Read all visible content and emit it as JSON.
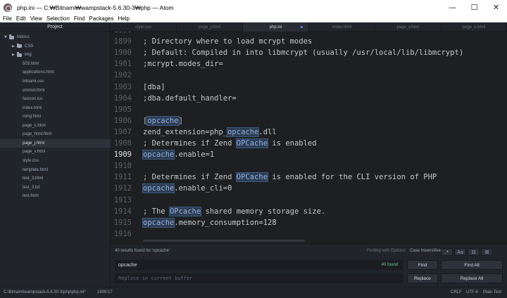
{
  "window": {
    "title": "php.ini — C:₩Bitnami₩wampstack-5.6.30-3₩php — Atom",
    "controls": {
      "minimize": "—",
      "maximize": "☐",
      "close": "✕"
    }
  },
  "menu": [
    "File",
    "Edit",
    "View",
    "Selection",
    "Find",
    "Packages",
    "Help"
  ],
  "tree": {
    "header": "Project",
    "items": [
      {
        "label": "htdocs",
        "type": "folder",
        "expanded": true
      },
      {
        "label": "CSS",
        "type": "folder",
        "expanded": false
      },
      {
        "label": "img",
        "type": "folder",
        "expanded": false
      },
      {
        "label": "503.html",
        "type": "file"
      },
      {
        "label": "applications.html",
        "type": "file"
      },
      {
        "label": "bitnami.css",
        "type": "file"
      },
      {
        "label": "emmet.html",
        "type": "file"
      },
      {
        "label": "favicon.ico",
        "type": "file"
      },
      {
        "label": "index.html",
        "type": "file"
      },
      {
        "label": "ming.html",
        "type": "file"
      },
      {
        "label": "page_c.html",
        "type": "file"
      },
      {
        "label": "page_html.html",
        "type": "file"
      },
      {
        "label": "page_j.html",
        "type": "file",
        "selected": true
      },
      {
        "label": "page_v.html",
        "type": "file"
      },
      {
        "label": "style.css",
        "type": "file"
      },
      {
        "label": "template.html",
        "type": "file"
      },
      {
        "label": "test_3.html",
        "type": "file"
      },
      {
        "label": "test_3.txt",
        "type": "file"
      },
      {
        "label": "test.html",
        "type": "file"
      }
    ]
  },
  "tabs": [
    {
      "label": "style.css"
    },
    {
      "label": "page_j.html"
    },
    {
      "label": "php.ini",
      "active": true,
      "modified": true
    },
    {
      "label": "index.html"
    },
    {
      "label": "page_v.html"
    },
    {
      "label": "page_c.html"
    }
  ],
  "editor": {
    "cursor_line": "1909",
    "lines": [
      {
        "num": "1898",
        "segs": []
      },
      {
        "num": "1899",
        "segs": [
          {
            "t": "; Directory where to load mcrypt modes"
          }
        ]
      },
      {
        "num": "1900",
        "segs": [
          {
            "t": "; Default: Compiled in into libmcrypt (usually /usr/local/lib/libmcrypt)"
          }
        ]
      },
      {
        "num": "1901",
        "segs": [
          {
            "t": ";mcrypt.modes_dir="
          }
        ]
      },
      {
        "num": "1902",
        "segs": []
      },
      {
        "num": "1903",
        "segs": [
          {
            "t": "[dba]"
          }
        ]
      },
      {
        "num": "1904",
        "segs": [
          {
            "t": ";dba.default_handler="
          }
        ]
      },
      {
        "num": "1905",
        "segs": []
      },
      {
        "num": "1906",
        "segs": [
          {
            "t": "["
          },
          {
            "t": "opcache",
            "h": true
          },
          {
            "t": "]"
          }
        ]
      },
      {
        "num": "1907",
        "segs": [
          {
            "t": "zend_extension=php_"
          },
          {
            "t": "opcache",
            "h": true
          },
          {
            "t": ".dll"
          }
        ]
      },
      {
        "num": "1908",
        "segs": [
          {
            "t": "; Determines if Zend "
          },
          {
            "t": "OPCache",
            "h": true
          },
          {
            "t": " is enabled"
          }
        ]
      },
      {
        "num": "1909",
        "segs": [
          {
            "t": "opcache",
            "h": true
          },
          {
            "t": ".enable=1"
          }
        ]
      },
      {
        "num": "1910",
        "segs": []
      },
      {
        "num": "1911",
        "segs": [
          {
            "t": "; Determines if Zend "
          },
          {
            "t": "OPCache",
            "h": true
          },
          {
            "t": " is enabled for the CLI version of PHP"
          }
        ]
      },
      {
        "num": "1912",
        "segs": [
          {
            "t": "opcache",
            "h": true
          },
          {
            "t": ".enable_cli=0"
          }
        ]
      },
      {
        "num": "1913",
        "segs": []
      },
      {
        "num": "1914",
        "segs": [
          {
            "t": "; The "
          },
          {
            "t": "OPcache",
            "h": true
          },
          {
            "t": " shared memory storage size."
          }
        ]
      },
      {
        "num": "1915",
        "segs": [
          {
            "t": "opcache",
            "h": true
          },
          {
            "t": ".memory_consumption=128"
          }
        ]
      },
      {
        "num": "1916",
        "segs": []
      }
    ]
  },
  "find": {
    "results_text": "40 results found for 'opcache'",
    "options_label": "Finding with Options:",
    "options_value": "Case Insensitive",
    "option_buttons": [
      ".*",
      "Aa",
      "⊟",
      "⊞"
    ],
    "find_value": "opcache",
    "found_count": "40 found",
    "replace_placeholder": "Replace in current buffer",
    "find_label": "Find",
    "find_all_label": "Find All",
    "replace_label": "Replace",
    "replace_all_label": "Replace All"
  },
  "status": {
    "path": "C:\\Bitnami\\wampstack-5.6.30-3\\php\\php.ini*",
    "cursor": "1909:17",
    "line_ending": "CRLF",
    "encoding": "UTF-8",
    "grammar": "Plain Text"
  }
}
